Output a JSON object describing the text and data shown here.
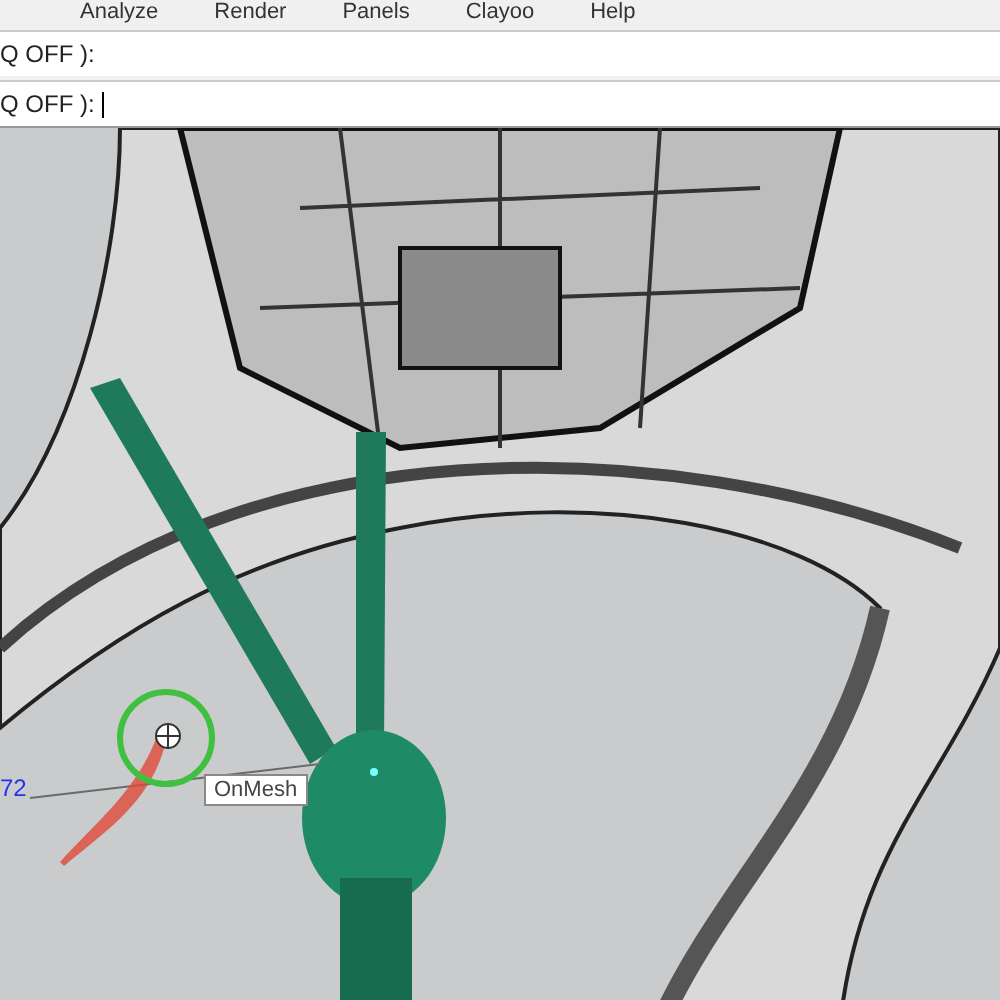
{
  "menu": [
    "Analyze",
    "Render",
    "Panels",
    "Clayoo",
    "Help"
  ],
  "command_history": "Q OFF ):",
  "command_prompt": "Q OFF ):",
  "viewport": {
    "coordinate_label": "72",
    "tooltip": "OnMesh"
  }
}
